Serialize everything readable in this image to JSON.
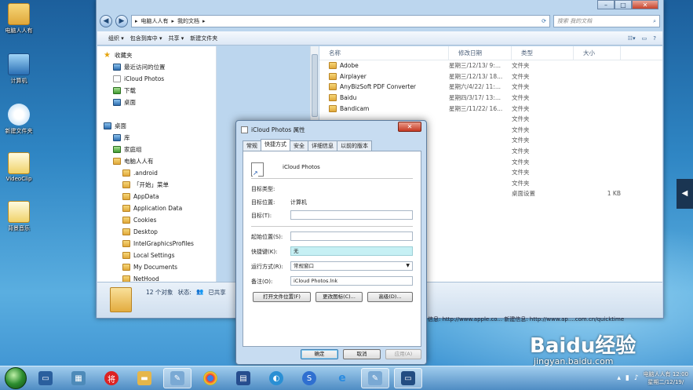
{
  "desktop": {
    "icons": [
      {
        "label": "电脑人人有",
        "icon": "folder-user-icon"
      },
      {
        "label": "计算机",
        "icon": "computer-icon"
      },
      {
        "label": "新建文件夹",
        "icon": "tiger-folder-icon"
      },
      {
        "label": "VideoClip",
        "icon": "video-file-icon"
      },
      {
        "label": "背景音乐",
        "icon": "music-file-icon"
      }
    ]
  },
  "explorer": {
    "breadcrumb": [
      "电脑人人有",
      "我的文档"
    ],
    "search_placeholder": "搜索 我的文档",
    "toolbar": [
      "组织 ▾",
      "包含到库中 ▾",
      "共享 ▾",
      "新建文件夹"
    ],
    "nav": [
      {
        "label": "收藏夹",
        "icon": "star-icon",
        "indent": 0
      },
      {
        "label": "最近访问的位置",
        "icon": "recent-icon",
        "indent": 1
      },
      {
        "label": "iCloud Photos",
        "icon": "file-icon",
        "indent": 1
      },
      {
        "label": "下载",
        "icon": "download-icon",
        "indent": 1
      },
      {
        "label": "桌面",
        "icon": "desktop-icon",
        "indent": 1
      },
      {
        "label": "",
        "icon": "",
        "indent": 0
      },
      {
        "label": "桌面",
        "icon": "desktop-icon",
        "indent": 0
      },
      {
        "label": "库",
        "icon": "library-icon",
        "indent": 1
      },
      {
        "label": "家庭组",
        "icon": "homegroup-icon",
        "indent": 1
      },
      {
        "label": "电脑人人有",
        "icon": "user-folder-icon",
        "indent": 1
      },
      {
        "label": ".android",
        "icon": "folder-icon",
        "indent": 2
      },
      {
        "label": "「开始」菜单",
        "icon": "folder-icon",
        "indent": 2
      },
      {
        "label": "AppData",
        "icon": "folder-icon",
        "indent": 2
      },
      {
        "label": "Application Data",
        "icon": "folder-icon",
        "indent": 2
      },
      {
        "label": "Cookies",
        "icon": "folder-icon",
        "indent": 2
      },
      {
        "label": "Desktop",
        "icon": "folder-icon",
        "indent": 2
      },
      {
        "label": "IntelGraphicsProfiles",
        "icon": "folder-icon",
        "indent": 2
      },
      {
        "label": "Local Settings",
        "icon": "folder-icon",
        "indent": 2
      },
      {
        "label": "My Documents",
        "icon": "folder-icon",
        "indent": 2
      },
      {
        "label": "NetHood",
        "icon": "folder-icon",
        "indent": 2
      }
    ],
    "columns": [
      "名称",
      "修改日期",
      "类型",
      "大小"
    ],
    "files": [
      {
        "name": "Adobe",
        "date": "星期三/12/13/ 9:...",
        "type": "文件夹",
        "size": ""
      },
      {
        "name": "Airplayer",
        "date": "星期三/12/13/ 18...",
        "type": "文件夹",
        "size": ""
      },
      {
        "name": "AnyBizSoft PDF Converter",
        "date": "星期六/4/22/ 11:...",
        "type": "文件夹",
        "size": ""
      },
      {
        "name": "Baidu",
        "date": "星期四/3/17/ 13:...",
        "type": "文件夹",
        "size": ""
      },
      {
        "name": "Bandicam",
        "date": "星期三/11/22/ 16...",
        "type": "文件夹",
        "size": ""
      },
      {
        "name": "",
        "date": "",
        "type": "文件夹",
        "size": ""
      },
      {
        "name": "",
        "date": "",
        "type": "文件夹",
        "size": ""
      },
      {
        "name": "",
        "date": "",
        "type": "文件夹",
        "size": ""
      },
      {
        "name": "",
        "date": "",
        "type": "文件夹",
        "size": ""
      },
      {
        "name": "",
        "date": "",
        "type": "文件夹",
        "size": ""
      },
      {
        "name": "",
        "date": "",
        "type": "文件夹",
        "size": ""
      },
      {
        "name": "",
        "date": "",
        "type": "文件夹",
        "size": ""
      },
      {
        "name": "",
        "date": "",
        "type": "桌面设置",
        "size": "1 KB"
      }
    ],
    "status": {
      "count": "12 个对象",
      "state_label": "状态:",
      "state_value": "已共享"
    },
    "behind_text": "信息: http://www.apple.co...  新建信息: http://www.ap....com.cn/quicktime"
  },
  "dialog": {
    "title": "iCloud Photos 属性",
    "tabs": [
      "常规",
      "快捷方式",
      "安全",
      "详细信息",
      "以前的版本"
    ],
    "active_tab": "快捷方式",
    "name": "iCloud Photos",
    "target_type_label": "目标类型:",
    "target_type_value": "",
    "target_location_label": "目标位置:",
    "target_location_value": "计算机",
    "target_label": "目标(T):",
    "target_value": "",
    "start_in_label": "起始位置(S):",
    "start_in_value": "",
    "shortcut_key_label": "快捷键(K):",
    "shortcut_key_value": "无",
    "run_label": "运行方式(R):",
    "run_value": "常规窗口",
    "comment_label": "备注(O):",
    "comment_value": "iCloud Photos.lnk",
    "btn_open_location": "打开文件位置(F)",
    "btn_change_icon": "更改图标(C)...",
    "btn_advanced": "高级(D)...",
    "btn_ok": "确定",
    "btn_cancel": "取消",
    "btn_apply": "应用(A)"
  },
  "taskbar": {
    "clock_user": "电脑人人有 12:00",
    "clock_date": "星期二/12/19/"
  },
  "watermark": {
    "main": "Baidu经验",
    "sub": "jingyan.baidu.com"
  }
}
